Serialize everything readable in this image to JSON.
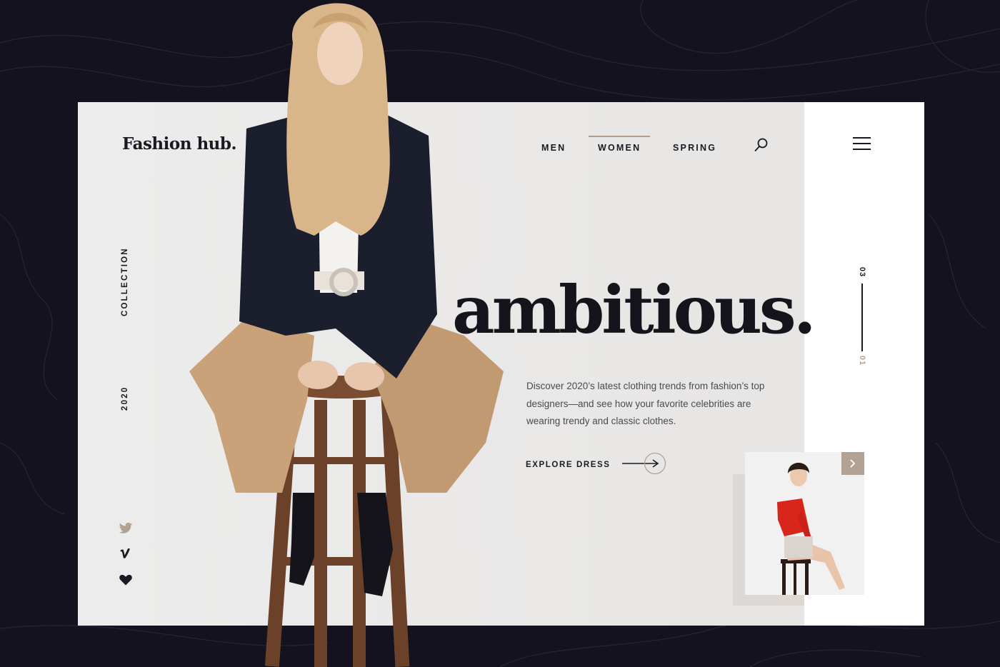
{
  "brand": {
    "logo": "Fashion hub."
  },
  "nav": {
    "items": [
      {
        "label": "MEN",
        "active": false
      },
      {
        "label": "WOMEN",
        "active": true
      },
      {
        "label": "SPRING",
        "active": false
      }
    ]
  },
  "side": {
    "collection": "COLLECTION",
    "year": "2020"
  },
  "hero": {
    "headline": "ambitious.",
    "description": "Discover 2020’s latest clothing trends from fashion’s top designers—and see how your favorite celebrities are wearing trendy and classic clothes.",
    "cta_label": "EXPLORE DRESS"
  },
  "slider": {
    "current": "01",
    "total": "03"
  },
  "social": [
    "twitter-icon",
    "vimeo-icon",
    "heart-icon"
  ],
  "colors": {
    "background": "#13121e",
    "card": "#ebebea",
    "accent": "#b3a293",
    "text": "#1a1a22",
    "thumb_dress": "#d9261c"
  }
}
